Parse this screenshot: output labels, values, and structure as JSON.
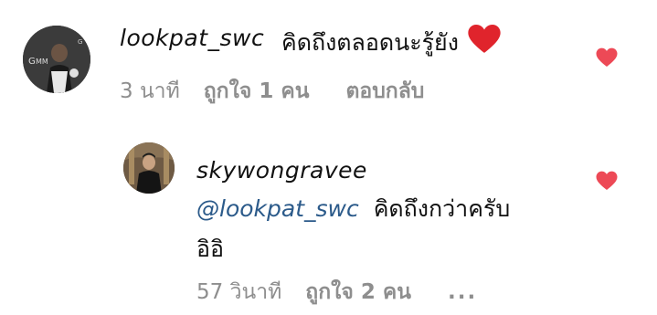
{
  "comments": [
    {
      "username": "lookpat_swc",
      "text": "คิดถึงตลอดนะรู้ยัง",
      "emoji_icon": "red-heart-emoji",
      "time": "3 นาที",
      "likes": "ถูกใจ 1 คน",
      "reply_label": "ตอบกลับ",
      "like_icon": "heart-icon",
      "accent": "#ed4956"
    },
    {
      "username": "skywongravee",
      "mention": "@lookpat_swc",
      "text_line1": "คิดถึงกว่าครับ",
      "text_line2": "อิอิ",
      "time": "57 วินาที",
      "likes": "ถูกใจ 2 คน",
      "more_label": "...",
      "like_icon": "heart-icon",
      "accent": "#ed4956"
    }
  ]
}
